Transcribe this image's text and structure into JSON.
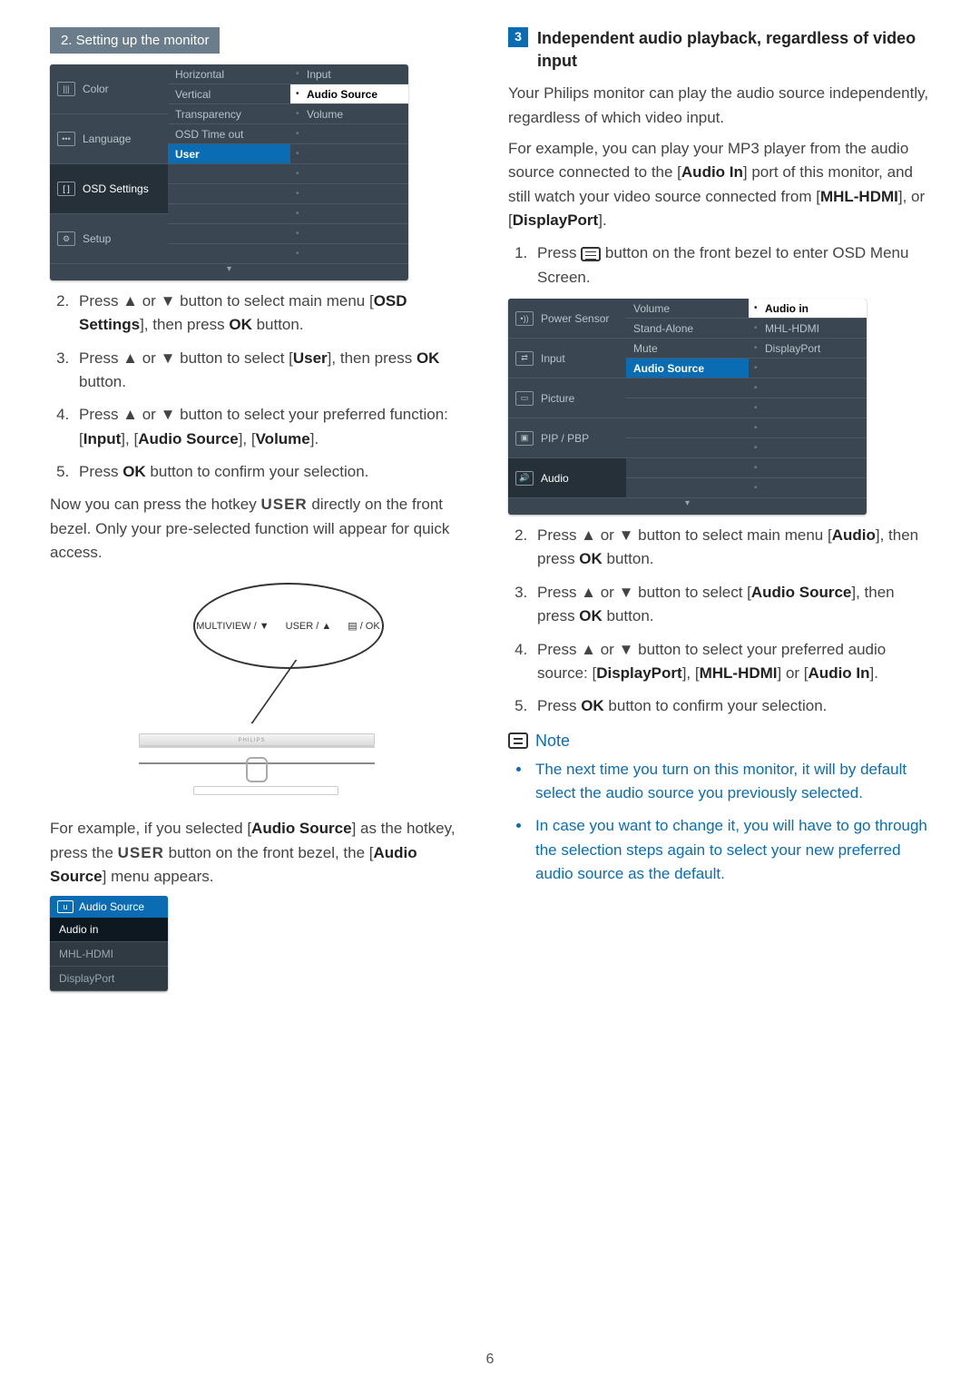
{
  "header": {
    "section": "2. Setting up the monitor"
  },
  "osd1": {
    "left": [
      {
        "icon": "|||",
        "label": "Color",
        "sel": false
      },
      {
        "icon": "•••",
        "label": "Language",
        "sel": false
      },
      {
        "icon": "[ ]",
        "label": "OSD Settings",
        "sel": true
      },
      {
        "icon": "⚙",
        "label": "Setup",
        "sel": false
      }
    ],
    "mid": [
      "Horizontal",
      "Vertical",
      "Transparency",
      "OSD Time out",
      "User",
      "",
      "",
      "",
      "",
      ""
    ],
    "mid_hl_index": 4,
    "right": [
      "Input",
      "Audio Source",
      "Volume",
      "",
      "",
      "",
      "",
      "",
      "",
      ""
    ],
    "right_hl_index": 1
  },
  "steps_left": [
    {
      "n": "2.",
      "text_pre": "Press ▲ or ▼ button to select main menu [",
      "bold1": "OSD Settings",
      "text_mid": "], then press ",
      "bold2": "OK",
      "text_post": " button."
    },
    {
      "n": "3.",
      "text_pre": "Press ▲ or ▼ button to select [",
      "bold1": "User",
      "text_mid": "], then press ",
      "bold2": "OK",
      "text_post": " button."
    },
    {
      "n": "4.",
      "text_pre": "Press ▲ or ▼ button to select your preferred function: [",
      "bold1": "Input",
      "text_mid": "], [",
      "bold2": "Audio Source",
      "text_post": "], [",
      "bold3": "Volume",
      "tail": "]."
    },
    {
      "n": "5.",
      "text_pre": "Press ",
      "bold1": "OK",
      "text_mid": " button to confirm your selection.",
      "bold2": "",
      "text_post": ""
    }
  ],
  "para_left_1a": "Now you can press the hotkey ",
  "para_left_1_user": "USER",
  "para_left_1b": " directly on the front bezel. Only your pre-selected function will appear for quick access.",
  "bezel_labels": {
    "a": "MULTIVIEW / ▼",
    "b": "USER / ▲",
    "c": "▤ / OK"
  },
  "para_left_2a": "For example, if you selected [",
  "para_left_2_bold1": "Audio Source",
  "para_left_2b": "] as the hotkey, press the ",
  "para_left_2_user": "USER",
  "para_left_2c": " button on the front bezel, the [",
  "para_left_2_bold2": "Audio Source",
  "para_left_2d": "] menu appears.",
  "mini_osd": {
    "title": "Audio Source",
    "items": [
      "Audio in",
      "MHL-HDMI",
      "DisplayPort"
    ],
    "active_index": 0
  },
  "right_heading_num": "3",
  "right_heading": "Independent audio playback, regardless of video input",
  "para_r1": "Your Philips monitor can play the audio source independently, regardless of which video input.",
  "para_r2a": "For example, you can play your MP3 player from the audio source connected to the [",
  "para_r2_b1": "Audio In",
  "para_r2b": "] port of this monitor, and still watch your video source connected from [",
  "para_r2_b2": "MHL-HDMI",
  "para_r2c": "], or [",
  "para_r2_b3": "DisplayPort",
  "para_r2d": "].",
  "step_r1a": "Press ",
  "step_r1b": " button on the front bezel to enter OSD Menu Screen.",
  "osd2": {
    "left": [
      {
        "icon": "•))",
        "label": "Power Sensor",
        "sel": false
      },
      {
        "icon": "⇄",
        "label": "Input",
        "sel": false
      },
      {
        "icon": "▭",
        "label": "Picture",
        "sel": false
      },
      {
        "icon": "▣",
        "label": "PIP / PBP",
        "sel": false
      },
      {
        "icon": "🔊",
        "label": "Audio",
        "sel": true
      }
    ],
    "mid": [
      "Volume",
      "Stand-Alone",
      "Mute",
      "Audio Source",
      "",
      "",
      "",
      "",
      "",
      ""
    ],
    "mid_hl_index": 3,
    "right": [
      "Audio in",
      "MHL-HDMI",
      "DisplayPort",
      "",
      "",
      "",
      "",
      "",
      "",
      ""
    ],
    "right_hl_index": 0
  },
  "steps_right": [
    {
      "pre": "Press ▲ or ▼ button to select main menu [",
      "b1": "Audio",
      "mid": "], then press ",
      "b2": "OK",
      "post": " button."
    },
    {
      "pre": "Press ▲ or ▼ button to select [",
      "b1": "Audio Source",
      "mid": "], then press ",
      "b2": "OK",
      "post": " button."
    },
    {
      "pre": "Press ▲ or ▼ button to select your preferred audio source: [",
      "b1": "DisplayPort",
      "mid": "], [",
      "b2": "MHL-HDMI",
      "post": "] or [",
      "b3": "Audio In",
      "tail": "]."
    },
    {
      "pre": "Press ",
      "b1": "OK",
      "mid": " button to confirm your selection.",
      "b2": "",
      "post": ""
    }
  ],
  "note_label": "Note",
  "notes": [
    "The next time you turn on this monitor, it will by default select the audio source you previously selected.",
    "In case you want to change it, you will have to go through the selection steps again to select your new preferred audio source as the default."
  ],
  "page_number": "6"
}
